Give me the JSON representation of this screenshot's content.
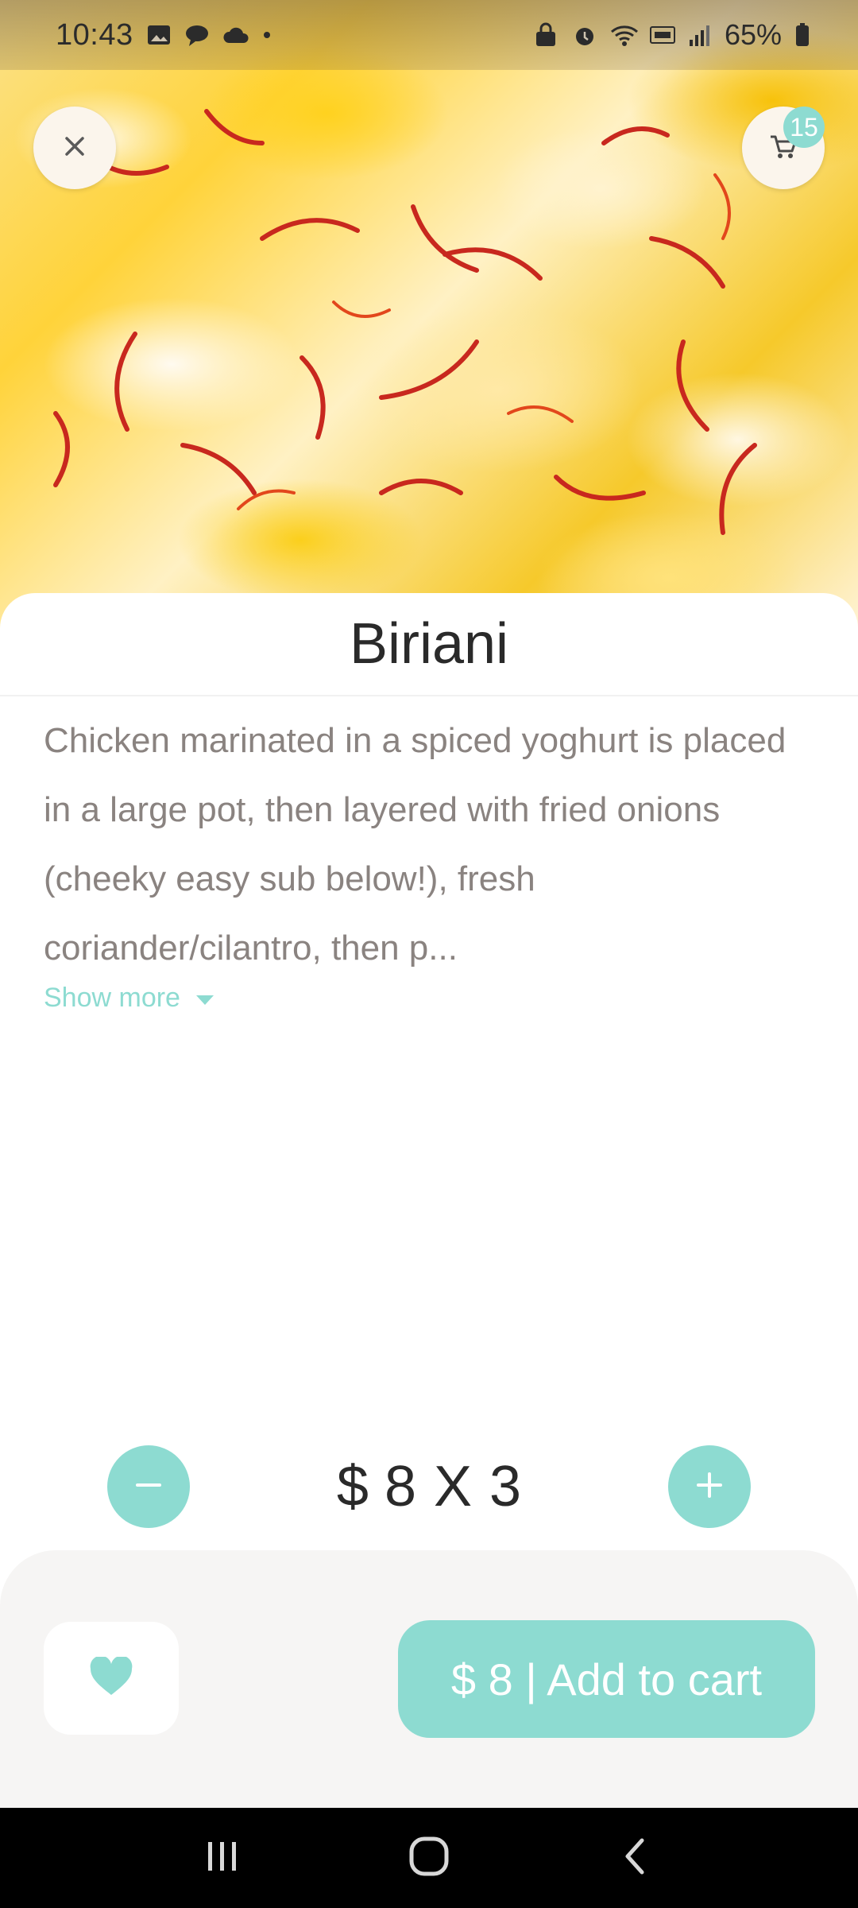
{
  "status_bar": {
    "time": "10:43",
    "battery": "65%",
    "left_icons": [
      "gallery-icon",
      "chat-icon",
      "cloud-icon",
      "dot-icon"
    ],
    "right_icons": [
      "lock-icon",
      "alarm-icon",
      "wifi-icon",
      "volte-icon",
      "signal-icon",
      "battery-icon"
    ]
  },
  "header": {
    "close_icon": "close-icon",
    "cart_icon": "cart-icon",
    "cart_count": "15"
  },
  "product": {
    "name": "Biriani",
    "description": "Chicken marinated in a spiced yoghurt is placed in a large pot, then layered with fried onions (cheeky easy sub below!), fresh coriander/cilantro, then p...",
    "show_more_label": "Show more",
    "price": "$ 8",
    "multiplier": "X",
    "quantity": "3"
  },
  "actions": {
    "add_to_cart_label": "$ 8 | Add to cart",
    "favorite_icon": "heart-icon"
  },
  "nav_bar": {
    "items": [
      "recents-icon",
      "home-icon",
      "back-icon"
    ]
  },
  "colors": {
    "accent": "#8ddbd1",
    "text_dark": "#2a2a2a",
    "text_muted": "#8a8380",
    "panel_bg": "#f6f5f4"
  }
}
